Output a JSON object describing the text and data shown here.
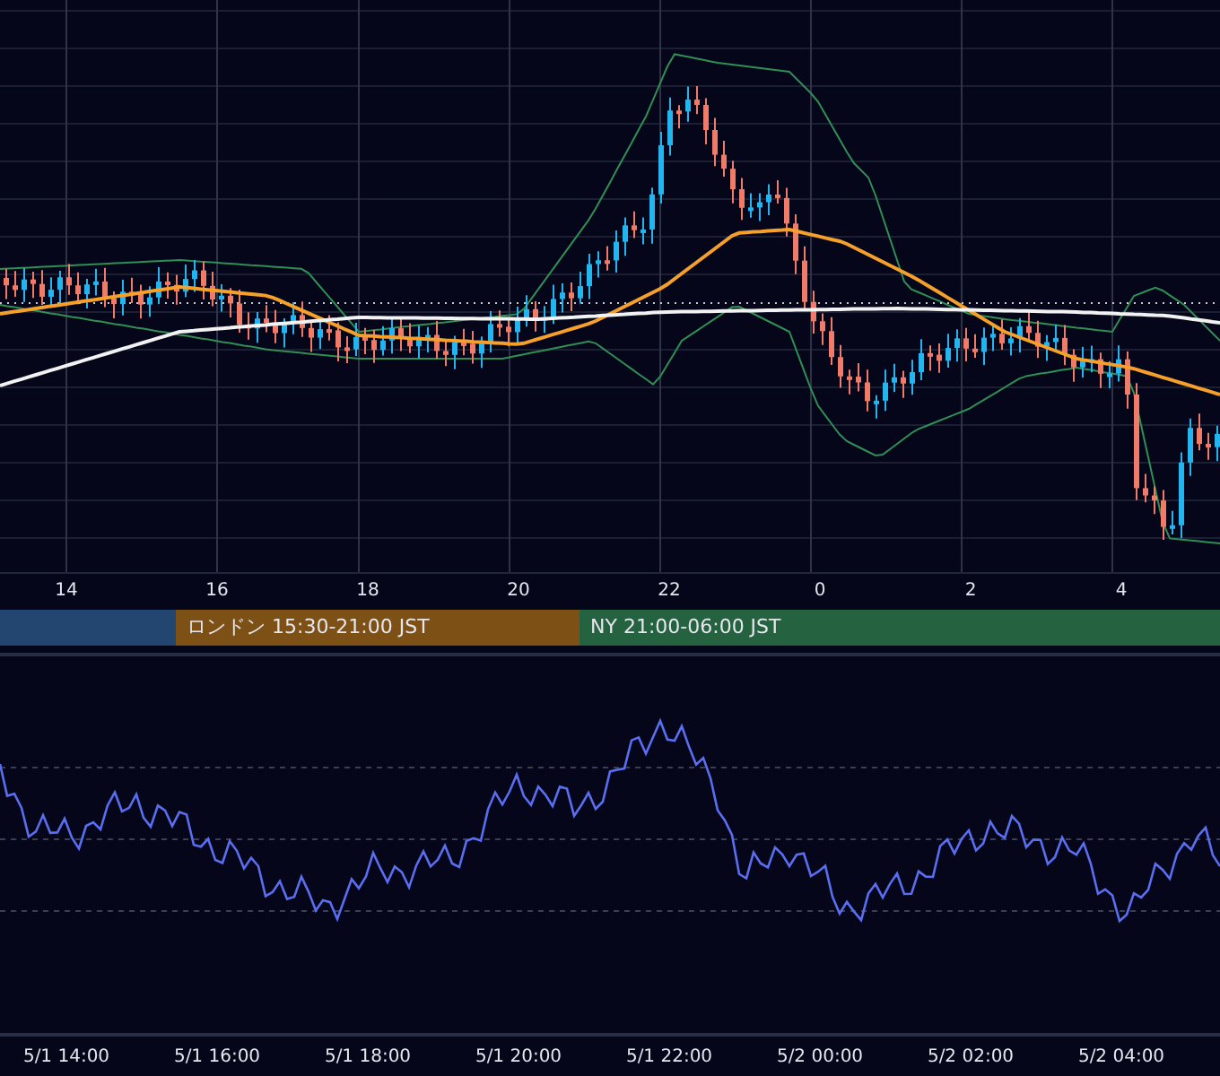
{
  "price_chart": {
    "kind": "candlestick"
  },
  "time_axis": {
    "labels": [
      "14",
      "16",
      "18",
      "20",
      "22",
      "0",
      "2",
      "4"
    ]
  },
  "sessions": [
    {
      "color": "#22466f"
    },
    {
      "label": "ロンドン 15:30-21:00 JST",
      "color": "#7d5116"
    },
    {
      "label": "NY 21:00-06:00 JST",
      "color": "#25623f"
    }
  ],
  "date_axis": {
    "labels": [
      "5/1 14:00",
      "5/1 16:00",
      "5/1 18:00",
      "5/1 20:00",
      "5/1 22:00",
      "5/2 00:00",
      "5/2 02:00",
      "5/2 04:00"
    ]
  }
}
